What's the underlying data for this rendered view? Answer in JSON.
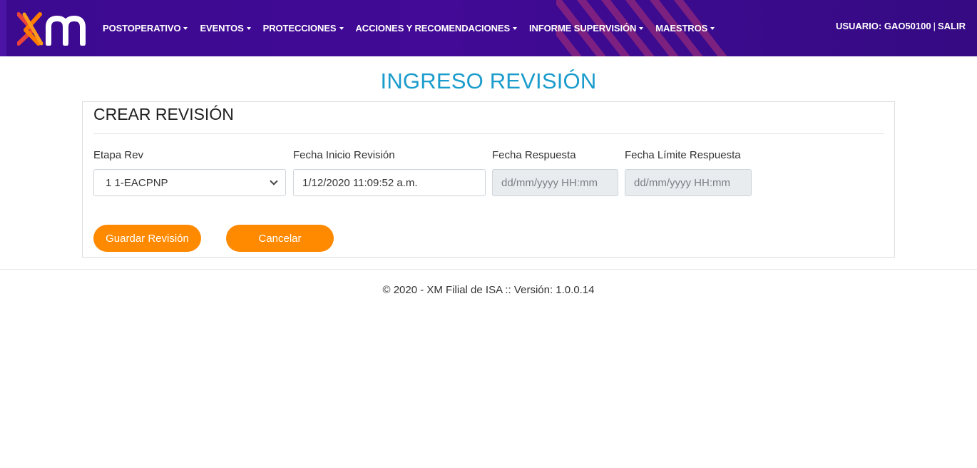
{
  "header": {
    "logo_alt": "xm",
    "menu": [
      {
        "label": "POSTOPERATIVO"
      },
      {
        "label": "EVENTOS"
      },
      {
        "label": "PROTECCIONES"
      },
      {
        "label": "ACCIONES Y RECOMENDACIONES"
      },
      {
        "label": "INFORME SUPERVISIÓN"
      },
      {
        "label": "MAESTROS"
      }
    ],
    "user_label": "USUARIO: GAO50100",
    "separator": "|",
    "logout_label": "SALIR"
  },
  "page": {
    "title": "INGRESO REVISIÓN"
  },
  "form": {
    "card_title": "CREAR REVISIÓN",
    "etapa": {
      "label": "Etapa Rev",
      "selected": "1 1-EACPNP"
    },
    "fecha_inicio": {
      "label": "Fecha Inicio Revisión",
      "value": "1/12/2020 11:09:52 a.m."
    },
    "fecha_respuesta": {
      "label": "Fecha Respuesta",
      "placeholder": "dd/mm/yyyy HH:mm"
    },
    "fecha_limite": {
      "label": "Fecha Límite Respuesta",
      "placeholder": "dd/mm/yyyy HH:mm"
    },
    "save_label": "Guardar Revisión",
    "cancel_label": "Cancelar"
  },
  "footer": {
    "text": "© 2020 - XM Filial de ISA :: Versión: 1.0.0.14"
  },
  "colors": {
    "header_bg": "#3b0a8f",
    "title": "#1a9ccc",
    "button": "#ff8a00",
    "logo_orange": "#ff7a00",
    "logo_red": "#e8423c"
  }
}
